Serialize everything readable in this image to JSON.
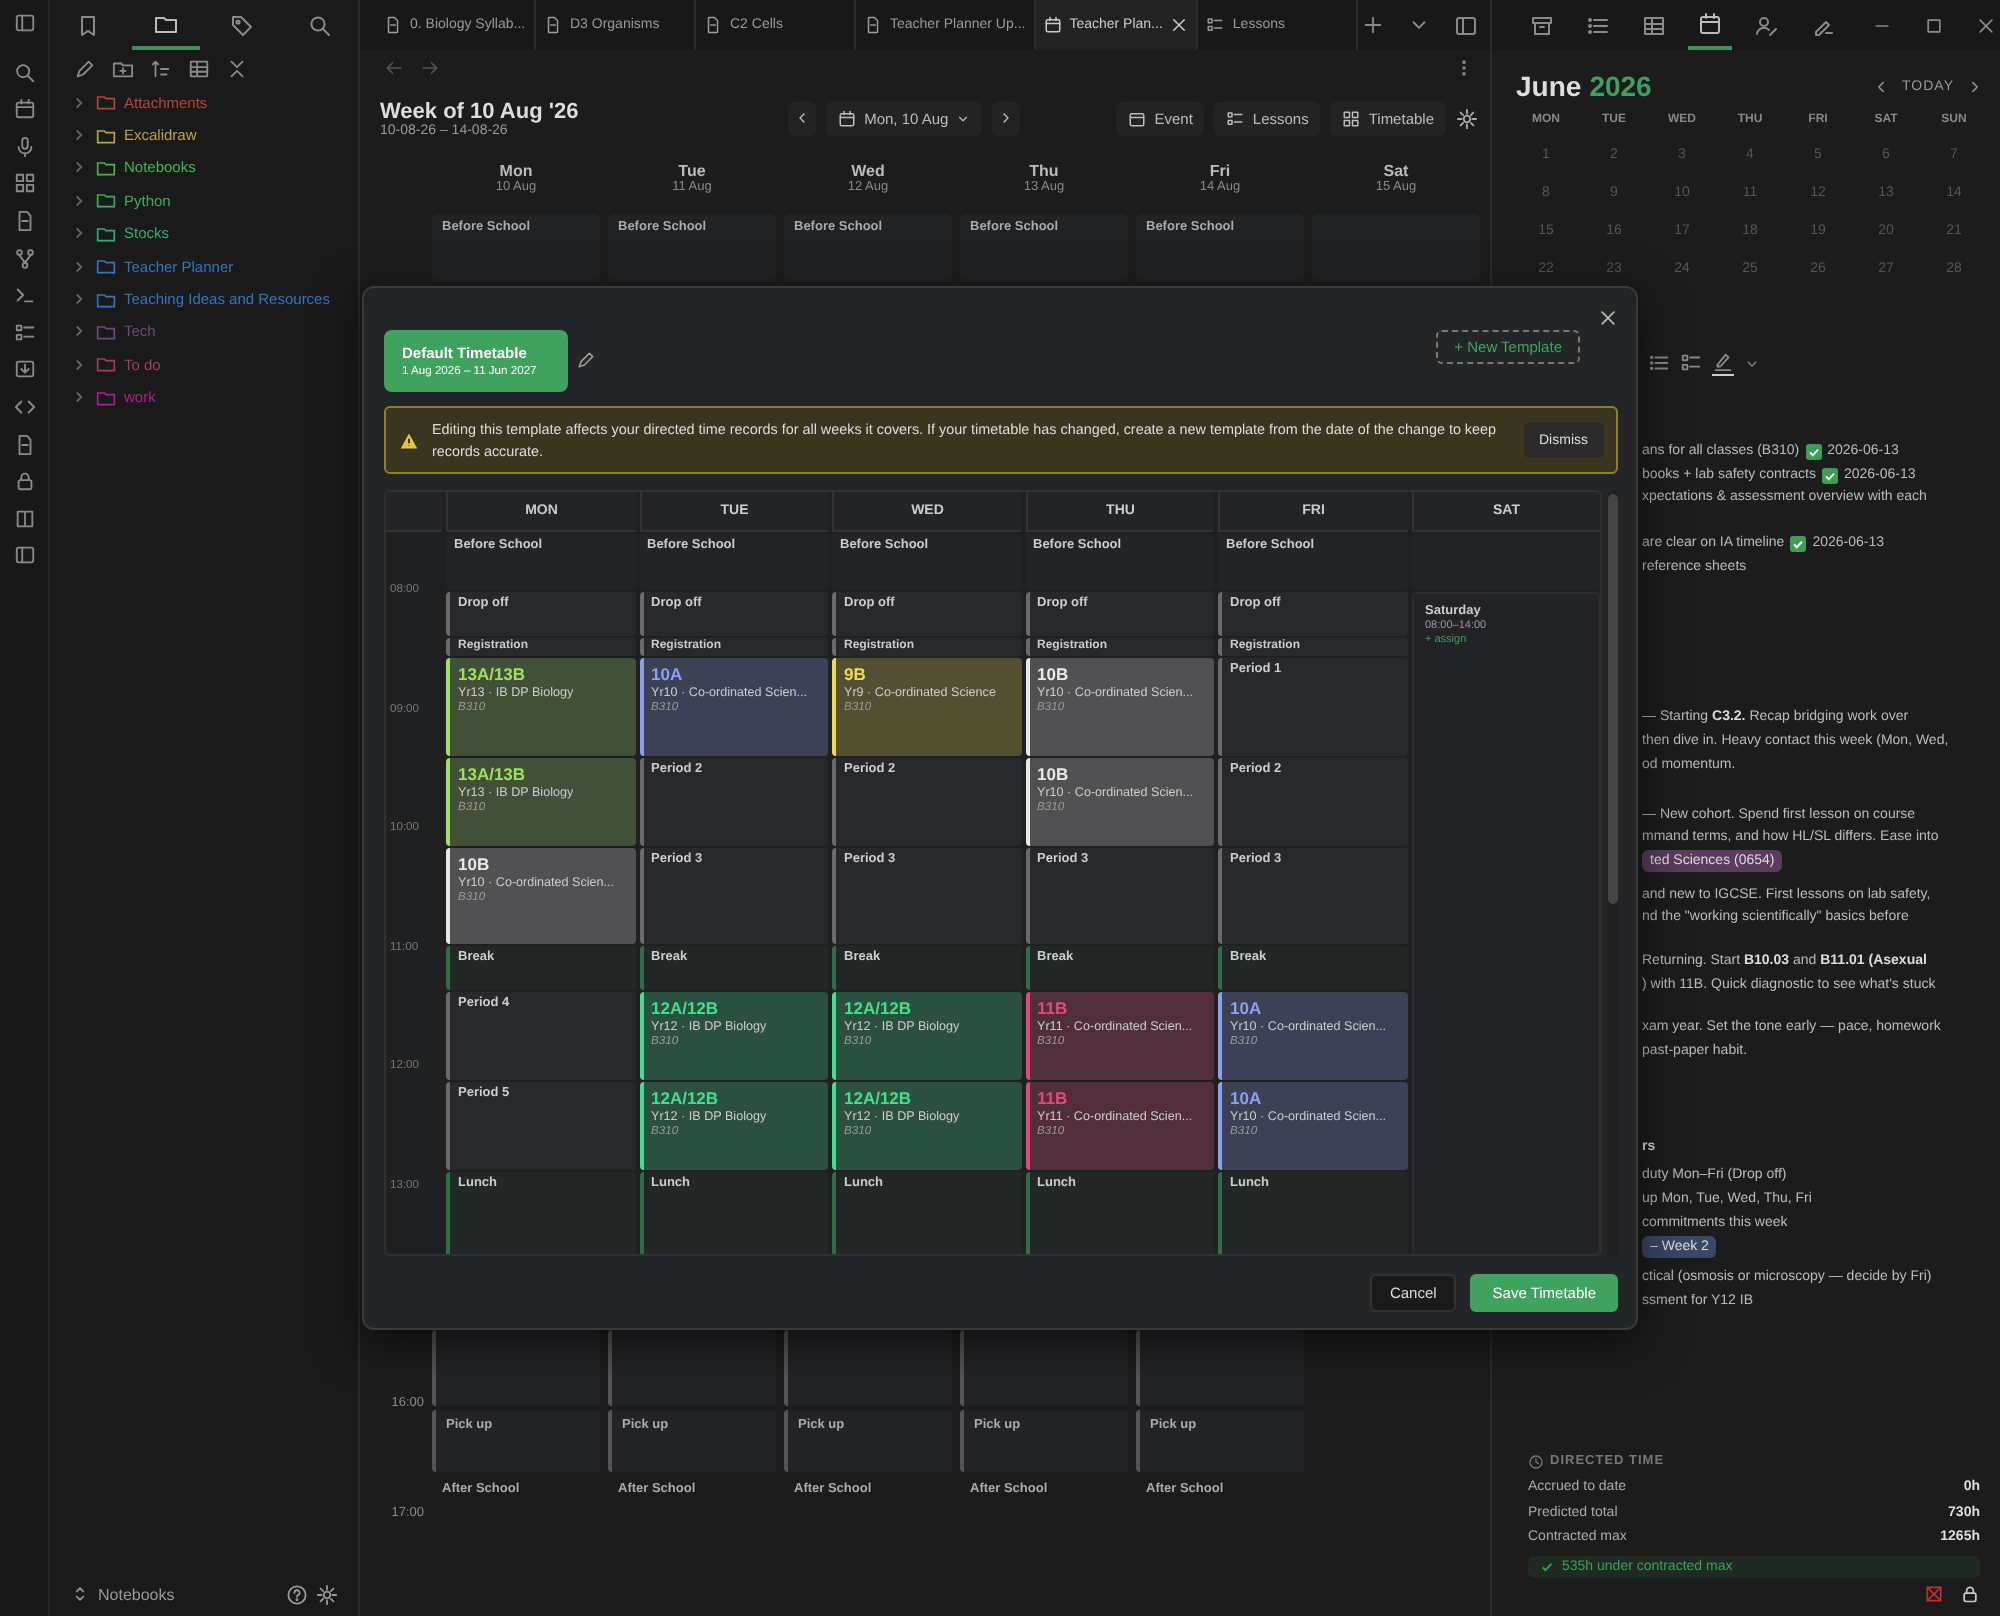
{
  "sidebar": {
    "tabs": [
      {
        "selected": false
      },
      {
        "selected": true
      },
      {
        "selected": false
      },
      {
        "selected": false
      }
    ],
    "items": [
      {
        "label": "Attachments",
        "color": "#b5453a",
        "expanded": false
      },
      {
        "label": "Excalidraw",
        "color": "#b8a83a",
        "expanded": false
      },
      {
        "label": "Notebooks",
        "color": "#45b845",
        "expanded": false
      },
      {
        "label": "Python",
        "color": "#3aae5e",
        "expanded": false
      },
      {
        "label": "Stocks",
        "color": "#2fae78",
        "expanded": false
      },
      {
        "label": "Teacher Planner",
        "color": "#3474c0",
        "expanded": false
      },
      {
        "label": "Teaching Ideas and Resources",
        "color": "#3474c0",
        "expanded": false
      },
      {
        "label": "Tech",
        "color": "#6a4e78",
        "expanded": false
      },
      {
        "label": "To do",
        "color": "#a83a60",
        "expanded": false
      },
      {
        "label": "work",
        "color": "#b01e92",
        "expanded": false
      }
    ],
    "vault": "Notebooks"
  },
  "tabs": [
    {
      "label": "0. Biology Syllab...",
      "selected": false
    },
    {
      "label": "D3 Organisms",
      "selected": false
    },
    {
      "label": "C2 Cells",
      "selected": false
    },
    {
      "label": "Teacher Planner Up...",
      "selected": false
    },
    {
      "label": "Teacher Plan...",
      "selected": true
    },
    {
      "label": "Lessons",
      "selected": false
    }
  ],
  "week_view": {
    "title": "Week of 10 Aug '26",
    "range": "10-08-26 – 14-08-26",
    "date_picker": "Mon, 10 Aug",
    "buttons": [
      "Event",
      "Lessons",
      "Timetable"
    ],
    "days": [
      {
        "name": "Mon",
        "date": "10 Aug",
        "before": "Before School",
        "pickup": "Pick up",
        "after": "After School"
      },
      {
        "name": "Tue",
        "date": "11 Aug",
        "before": "Before School",
        "pickup": "Pick up",
        "after": "After School"
      },
      {
        "name": "Wed",
        "date": "12 Aug",
        "before": "Before School",
        "pickup": "Pick up",
        "after": "After School"
      },
      {
        "name": "Thu",
        "date": "13 Aug",
        "before": "Before School",
        "pickup": "Pick up",
        "after": "After School"
      },
      {
        "name": "Fri",
        "date": "14 Aug",
        "before": "Before School",
        "pickup": "Pick up",
        "after": "After School"
      },
      {
        "name": "Sat",
        "date": "15 Aug"
      }
    ],
    "times": [
      "16:00",
      "17:00"
    ]
  },
  "panel_tabs": [
    {
      "selected": false
    },
    {
      "selected": false
    },
    {
      "selected": false
    },
    {
      "selected": true
    },
    {
      "selected": false
    },
    {
      "selected": false
    }
  ],
  "calendar": {
    "month": "June",
    "year": "2026",
    "today": "TODAY",
    "weekdays": [
      "MON",
      "TUE",
      "WED",
      "THU",
      "FRI",
      "SAT",
      "SUN"
    ],
    "weeks": [
      [
        "1",
        "2",
        "3",
        "4",
        "5",
        "6",
        "7"
      ],
      [
        "8",
        "9",
        "10",
        "11",
        "12",
        "13",
        "14"
      ],
      [
        "15",
        "16",
        "17",
        "18",
        "19",
        "20",
        "21"
      ],
      [
        "22",
        "23",
        "24",
        "25",
        "26",
        "27",
        "28"
      ]
    ]
  },
  "notes": [
    {
      "lines": [
        {
          "kind": "task",
          "text": "ans for all classes (B310)",
          "date": "2026-06-13"
        },
        {
          "kind": "task",
          "text": "books + lab safety contracts",
          "date": "2026-06-13"
        },
        {
          "kind": "text",
          "text": "xpectations & assessment overview with each"
        }
      ]
    },
    {
      "lines": [
        {
          "kind": "task",
          "text": "are clear on IA timeline",
          "date": "2026-06-13"
        },
        {
          "kind": "text",
          "text": "reference sheets"
        }
      ]
    },
    {
      "lines": [
        {
          "kind": "text",
          "text": "— Starting **C3.2.** Recap bridging work over"
        },
        {
          "kind": "text",
          "text": "then dive in. Heavy contact this week (Mon, Wed,"
        },
        {
          "kind": "text",
          "text": "od momentum."
        }
      ]
    },
    {
      "lines": [
        {
          "kind": "text",
          "text": "— New cohort. Spend first lesson on course"
        },
        {
          "kind": "text",
          "text": "mmand terms, and how HL/SL differs. Ease into"
        },
        {
          "kind": "tag",
          "text": "ted Sciences (0654)",
          "color": "#5b3b5e"
        }
      ]
    },
    {
      "lines": [
        {
          "kind": "text",
          "text": "and new to IGCSE. First lessons on lab safety,"
        },
        {
          "kind": "text",
          "text": "nd the \"working scientifically\" basics before"
        }
      ]
    },
    {
      "lines": [
        {
          "kind": "text",
          "text": "Returning. Start **B10.03** and **B11.01 (Asexual**"
        },
        {
          "kind": "text",
          "text": ") with 11B. Quick diagnostic to see what's stuck"
        }
      ]
    },
    {
      "lines": [
        {
          "kind": "text",
          "text": "xam year. Set the tone early — pace, homework"
        },
        {
          "kind": "text",
          "text": "past-paper habit."
        }
      ]
    },
    {
      "lines": [
        {
          "kind": "heading",
          "text": "rs"
        }
      ]
    },
    {
      "lines": [
        {
          "kind": "text",
          "text": "duty Mon–Fri (Drop off)"
        },
        {
          "kind": "text",
          "text": "up Mon, Tue, Wed, Thu, Fri"
        },
        {
          "kind": "text",
          "text": "commitments this week"
        },
        {
          "kind": "tag",
          "text": "– Week 2",
          "color": "#3b4766"
        }
      ]
    },
    {
      "lines": [
        {
          "kind": "text",
          "text": "ctical (osmosis or microscopy — decide by Fri)"
        },
        {
          "kind": "text",
          "text": "ssment for Y12 IB"
        }
      ]
    }
  ],
  "directed_time": {
    "title": "DIRECTED TIME",
    "rows": [
      {
        "label": "Accrued to date",
        "value": "0h"
      },
      {
        "label": "Predicted total",
        "value": "730h"
      },
      {
        "label": "Contracted max",
        "value": "1265h"
      }
    ],
    "note": "535h under contracted max"
  },
  "modal": {
    "template": {
      "name": "Default Timetable",
      "dates": "1 Aug 2026 – 11 Jun 2027",
      "selected": true
    },
    "new_template": "+ New Template",
    "warning": {
      "text": "Editing this template affects your directed time records for all weeks it covers. If your timetable has changed, create a new template from the date of the change to keep records accurate.",
      "dismiss": "Dismiss"
    },
    "times": [
      "08:00",
      "09:00",
      "10:00",
      "11:00",
      "12:00",
      "13:00"
    ],
    "days": [
      {
        "name": "MON",
        "slots": [
          {
            "kind": "plain",
            "label": "Before School"
          },
          {
            "kind": "period",
            "label": "Drop off"
          },
          {
            "kind": "period",
            "label": "Registration"
          },
          {
            "kind": "lesson",
            "code": "13A/13B",
            "subject": "Yr13 · IB DP Biology",
            "room": "B310",
            "color": "#9fe060"
          },
          {
            "kind": "lesson",
            "code": "13A/13B",
            "subject": "Yr13 · IB DP Biology",
            "room": "B310",
            "color": "#9fe060"
          },
          {
            "kind": "lesson",
            "code": "10B",
            "subject": "Yr10 · Co-ordinated Scien...",
            "room": "B310",
            "color": "#e8e8e8"
          },
          {
            "kind": "break",
            "label": "Break"
          },
          {
            "kind": "period",
            "label": "Period 4"
          },
          {
            "kind": "period",
            "label": "Period 5"
          },
          {
            "kind": "break",
            "label": "Lunch"
          }
        ]
      },
      {
        "name": "TUE",
        "slots": [
          {
            "kind": "plain",
            "label": "Before School"
          },
          {
            "kind": "period",
            "label": "Drop off"
          },
          {
            "kind": "period",
            "label": "Registration"
          },
          {
            "kind": "lesson",
            "code": "10A",
            "subject": "Yr10 · Co-ordinated Scien...",
            "room": "B310",
            "color": "#8c9ff0"
          },
          {
            "kind": "period",
            "label": "Period 2"
          },
          {
            "kind": "period",
            "label": "Period 3"
          },
          {
            "kind": "break",
            "label": "Break"
          },
          {
            "kind": "lesson",
            "code": "12A/12B",
            "subject": "Yr12 · IB DP Biology",
            "room": "B310",
            "color": "#3ee08a"
          },
          {
            "kind": "lesson",
            "code": "12A/12B",
            "subject": "Yr12 · IB DP Biology",
            "room": "B310",
            "color": "#3ee08a"
          },
          {
            "kind": "break",
            "label": "Lunch"
          }
        ]
      },
      {
        "name": "WED",
        "slots": [
          {
            "kind": "plain",
            "label": "Before School"
          },
          {
            "kind": "period",
            "label": "Drop off"
          },
          {
            "kind": "period",
            "label": "Registration"
          },
          {
            "kind": "lesson",
            "code": "9B",
            "subject": "Yr9 · Co-ordinated Science",
            "room": "B310",
            "color": "#f0dc50"
          },
          {
            "kind": "period",
            "label": "Period 2"
          },
          {
            "kind": "period",
            "label": "Period 3"
          },
          {
            "kind": "break",
            "label": "Break"
          },
          {
            "kind": "lesson",
            "code": "12A/12B",
            "subject": "Yr12 · IB DP Biology",
            "room": "B310",
            "color": "#3ee08a"
          },
          {
            "kind": "lesson",
            "code": "12A/12B",
            "subject": "Yr12 · IB DP Biology",
            "room": "B310",
            "color": "#3ee08a"
          },
          {
            "kind": "break",
            "label": "Lunch"
          }
        ]
      },
      {
        "name": "THU",
        "slots": [
          {
            "kind": "plain",
            "label": "Before School"
          },
          {
            "kind": "period",
            "label": "Drop off"
          },
          {
            "kind": "period",
            "label": "Registration"
          },
          {
            "kind": "lesson",
            "code": "10B",
            "subject": "Yr10 · Co-ordinated Scien...",
            "room": "B310",
            "color": "#e8e8e8"
          },
          {
            "kind": "lesson",
            "code": "10B",
            "subject": "Yr10 · Co-ordinated Scien...",
            "room": "B310",
            "color": "#e8e8e8"
          },
          {
            "kind": "period",
            "label": "Period 3"
          },
          {
            "kind": "break",
            "label": "Break"
          },
          {
            "kind": "lesson",
            "code": "11B",
            "subject": "Yr11 · Co-ordinated Scien...",
            "room": "B310",
            "color": "#e8467a"
          },
          {
            "kind": "lesson",
            "code": "11B",
            "subject": "Yr11 · Co-ordinated Scien...",
            "room": "B310",
            "color": "#e8467a"
          },
          {
            "kind": "break",
            "label": "Lunch"
          }
        ]
      },
      {
        "name": "FRI",
        "slots": [
          {
            "kind": "plain",
            "label": "Before School"
          },
          {
            "kind": "period",
            "label": "Drop off"
          },
          {
            "kind": "period",
            "label": "Registration"
          },
          {
            "kind": "period",
            "label": "Period 1"
          },
          {
            "kind": "period",
            "label": "Period 2"
          },
          {
            "kind": "period",
            "label": "Period 3"
          },
          {
            "kind": "break",
            "label": "Break"
          },
          {
            "kind": "lesson",
            "code": "10A",
            "subject": "Yr10 · Co-ordinated Scien...",
            "room": "B310",
            "color": "#8c9ff0"
          },
          {
            "kind": "lesson",
            "code": "10A",
            "subject": "Yr10 · Co-ordinated Scien...",
            "room": "B310",
            "color": "#8c9ff0"
          },
          {
            "kind": "break",
            "label": "Lunch"
          }
        ]
      },
      {
        "name": "SAT",
        "slots": [
          {
            "kind": "empty"
          },
          {
            "kind": "day_block",
            "title": "Saturday",
            "hours": "08:00–14:00",
            "action": "+ assign"
          }
        ]
      }
    ],
    "buttons": [
      {
        "label": "Cancel",
        "kind": "secondary"
      },
      {
        "label": "Save Timetable",
        "kind": "primary"
      }
    ]
  }
}
